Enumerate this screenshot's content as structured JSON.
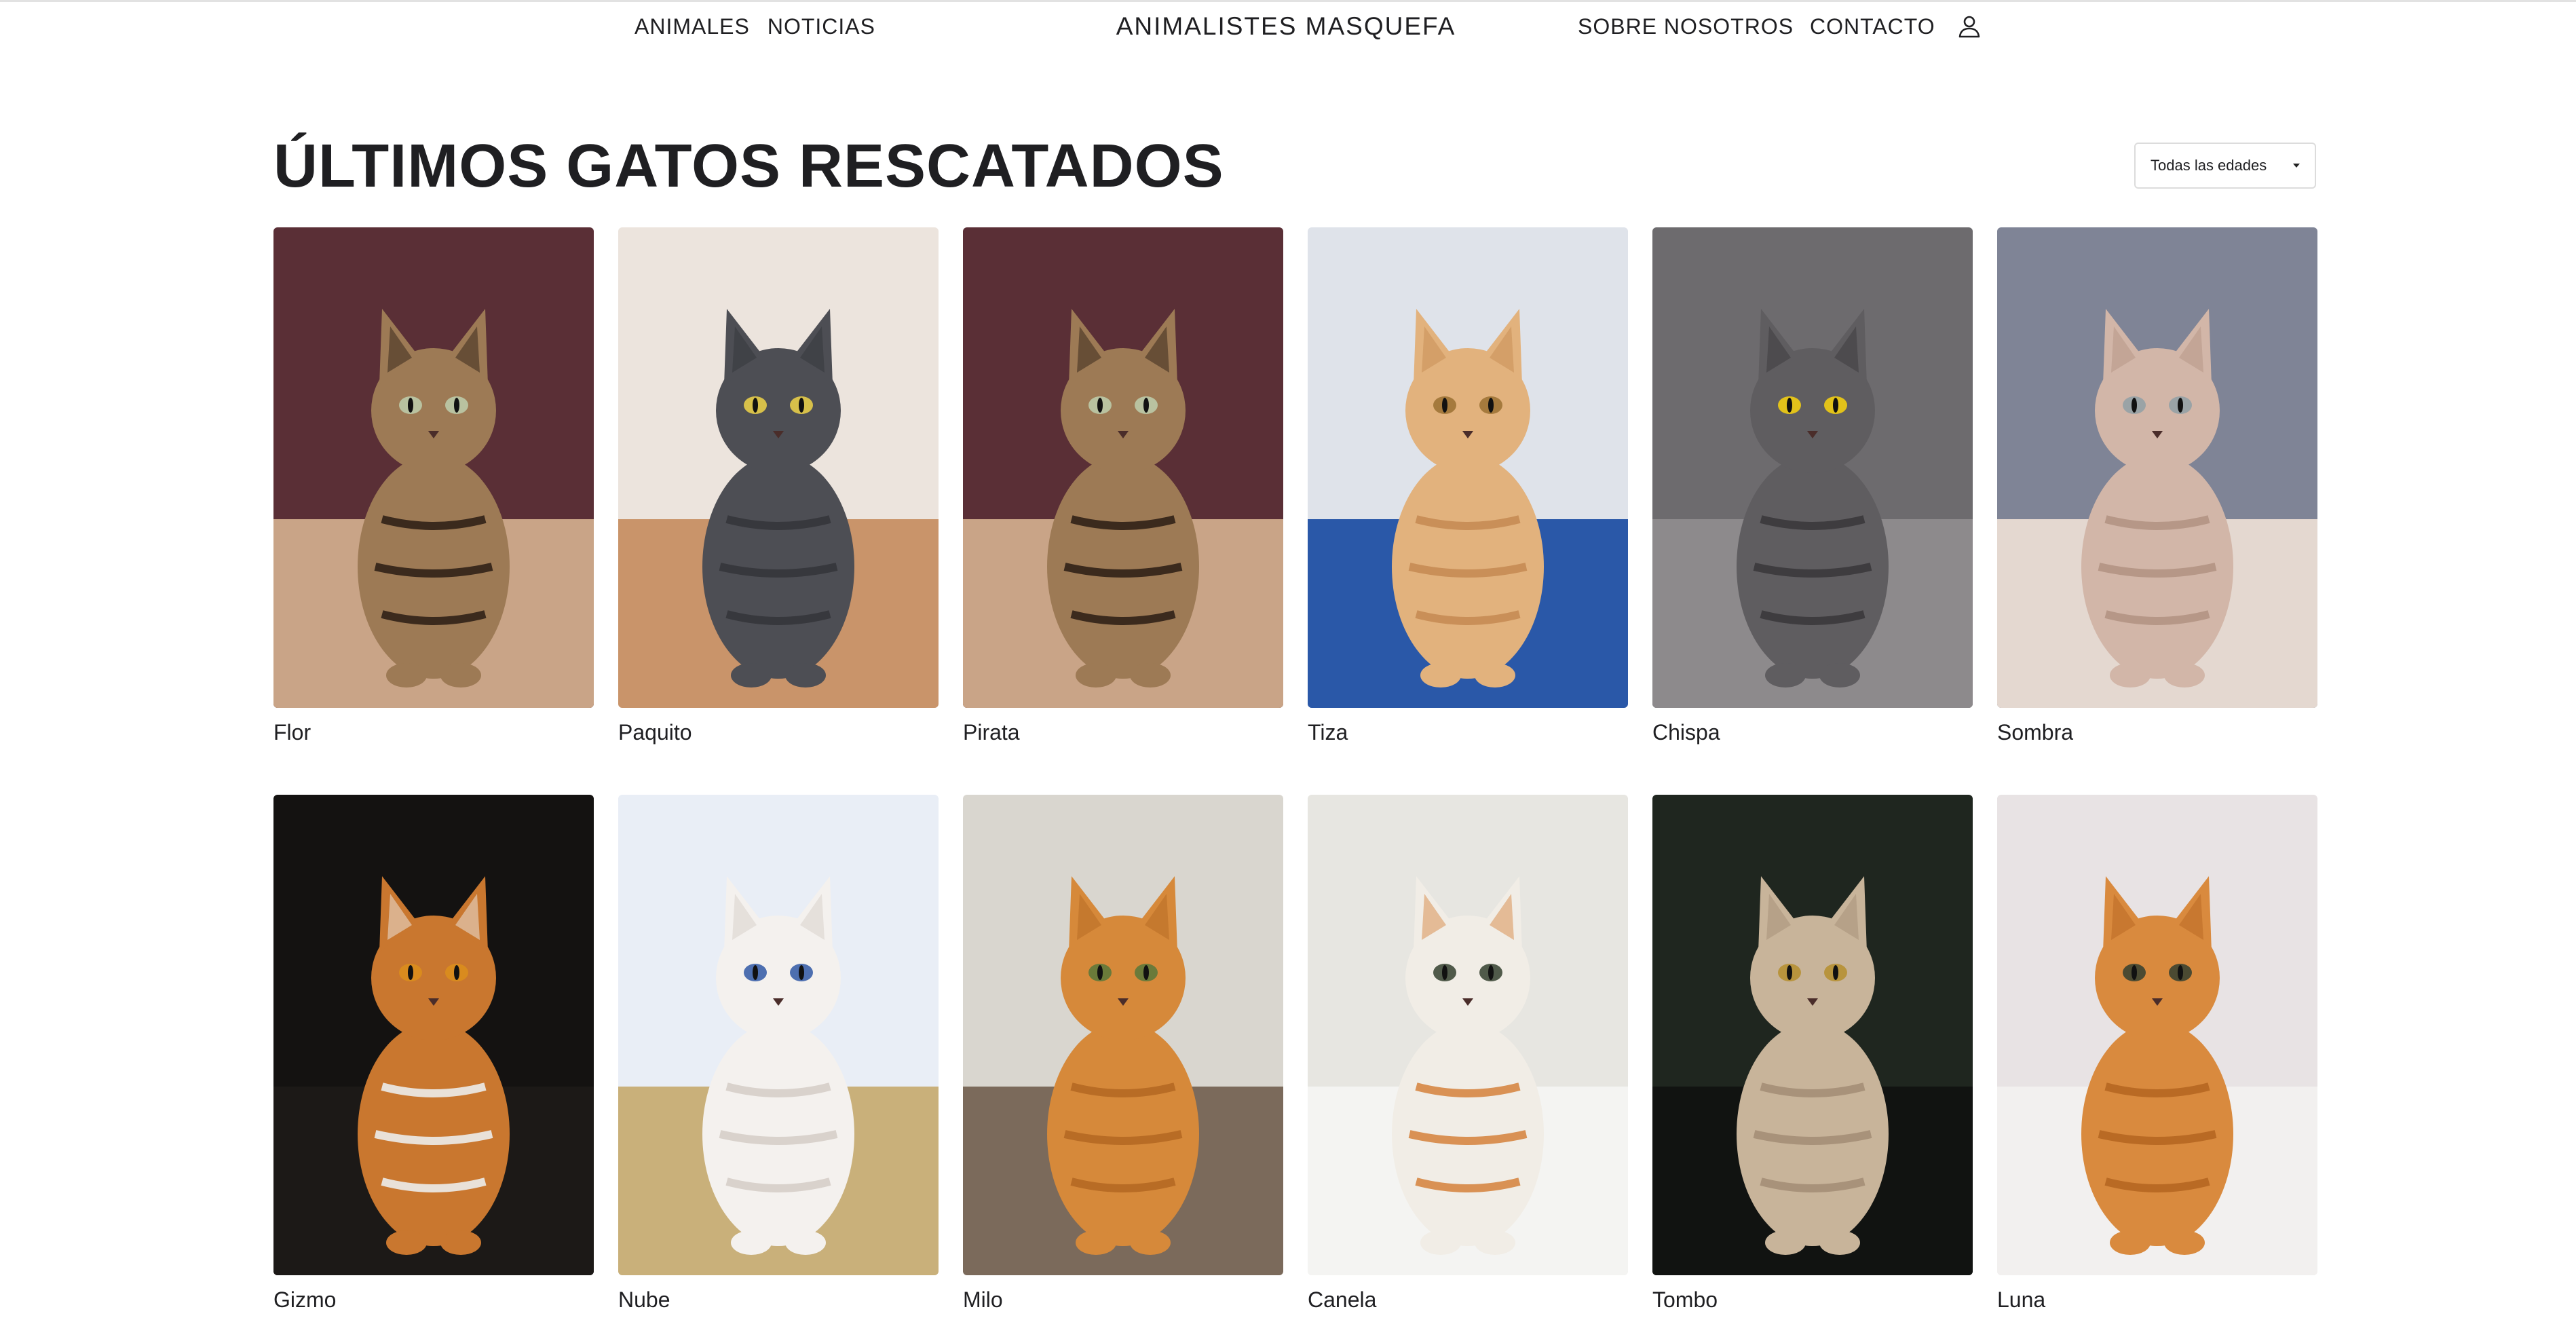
{
  "header": {
    "nav_left": [
      "ANIMALES",
      "NOTICIAS"
    ],
    "brand": "ANIMALISTES MASQUEFA",
    "nav_right": [
      "SOBRE NOSOTROS",
      "CONTACTO"
    ],
    "account_icon": "user-icon"
  },
  "main": {
    "title": "ÚLTIMOS GATOS RESCATADOS",
    "filter": {
      "selected": "Todas las edades",
      "icon": "chevron-down-icon"
    },
    "cats": [
      {
        "name": "Flor",
        "photo": {
          "bg": "#5a2f36",
          "floor": "#c9a487",
          "body": "#9d7a55",
          "stripe": "#3b2a1d",
          "eye": "#b9c2a0"
        }
      },
      {
        "name": "Paquito",
        "photo": {
          "bg": "#ece4dd",
          "floor": "#c9946a",
          "body": "#4d4e54",
          "stripe": "#37383d",
          "eye": "#d7c04a"
        }
      },
      {
        "name": "Pirata",
        "photo": {
          "bg": "#5a2f36",
          "floor": "#c9a487",
          "body": "#9d7a55",
          "stripe": "#3b2a1d",
          "eye": "#b9c2a0"
        }
      },
      {
        "name": "Tiza",
        "photo": {
          "bg": "#dfe3ea",
          "floor": "#2a58a8",
          "body": "#e2b27d",
          "stripe": "#c98f58",
          "eye": "#a57a3d"
        }
      },
      {
        "name": "Chispa",
        "photo": {
          "bg": "#6d6b6e",
          "floor": "#8d8a8c",
          "body": "#5f5d60",
          "stripe": "#3e3c3f",
          "eye": "#e2c21a"
        }
      },
      {
        "name": "Sombra",
        "photo": {
          "bg": "#7f8496",
          "floor": "#e4d8d0",
          "body": "#d2b6a8",
          "stripe": "#b69787",
          "eye": "#9aa3a6"
        }
      },
      {
        "name": "Gizmo",
        "photo": {
          "bg": "#141211",
          "floor": "#1c1917",
          "body": "#c9772f",
          "stripe": "#e9e1d8",
          "eye": "#d98b1e"
        }
      },
      {
        "name": "Nube",
        "photo": {
          "bg": "#e9eef6",
          "floor": "#c9b07a",
          "body": "#f4f1ee",
          "stripe": "#d9d2cc",
          "eye": "#4d6fb0"
        }
      },
      {
        "name": "Milo",
        "photo": {
          "bg": "#d9d6cf",
          "floor": "#7b6a5b",
          "body": "#d6893a",
          "stripe": "#b86c25",
          "eye": "#6a7a3a"
        }
      },
      {
        "name": "Canela",
        "photo": {
          "bg": "#e7e6e1",
          "floor": "#f4f4f2",
          "body": "#f1ede6",
          "stripe": "#d99154",
          "eye": "#505a4a"
        }
      },
      {
        "name": "Tombo",
        "photo": {
          "bg": "#1f261f",
          "floor": "#111311",
          "body": "#c8b49a",
          "stripe": "#a8927a",
          "eye": "#b8943d"
        }
      },
      {
        "name": "Luna",
        "photo": {
          "bg": "#e8e3e4",
          "floor": "#f2f0ef",
          "body": "#d98a3e",
          "stripe": "#b96a24",
          "eye": "#4b4a32"
        }
      }
    ]
  }
}
